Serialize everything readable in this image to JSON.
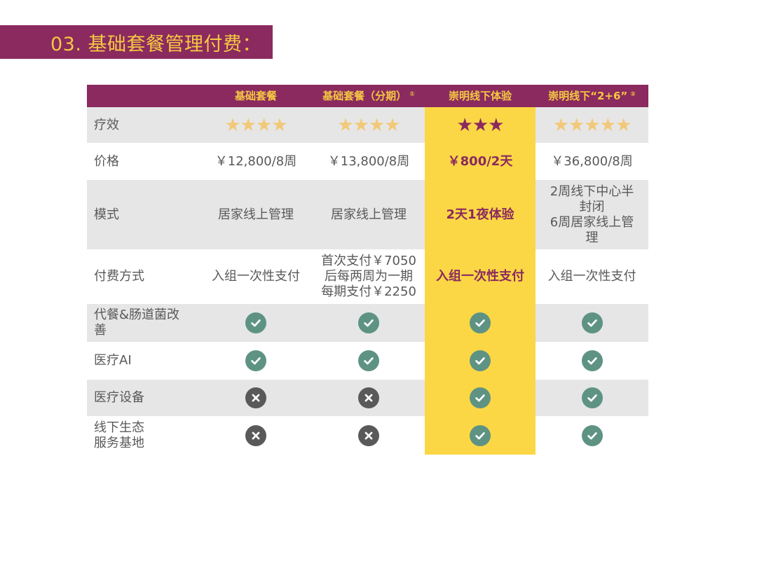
{
  "title": "03. 基础套餐管理付费：",
  "colors": {
    "accent": "#8a2a5f",
    "gold": "#f5c842",
    "highlight": "#fbd745",
    "check": "#5e9384",
    "cross": "#595959"
  },
  "header": {
    "col1": "基础套餐",
    "col2": "基础套餐（分期）",
    "col2_sup": "①",
    "col3": "崇明线下体验",
    "col4": "崇明线下“2+6”",
    "col4_sup": "②"
  },
  "rows": {
    "efficacy": {
      "label": "疗效",
      "c1": "★★★★",
      "c2": "★★★★",
      "c3": "★★★",
      "c4": "★★★★★"
    },
    "price": {
      "label": "价格",
      "c1": "￥12,800/8周",
      "c2": "￥13,800/8周",
      "c3": "￥800/2天",
      "c4": "￥36,800/8周"
    },
    "mode": {
      "label": "模式",
      "c1": "居家线上管理",
      "c2": "居家线上管理",
      "c3": "2天1夜体验",
      "c4_line1": "2周线下中心半",
      "c4_line2": "封闭",
      "c4_line3": "6周居家线上管",
      "c4_line4": "理"
    },
    "payment": {
      "label": "付费方式",
      "c1": "入组一次性支付",
      "c2_line1": "首次支付￥7050",
      "c2_line2": "后每两周为一期",
      "c2_line3": "每期支付￥2250",
      "c3": "入组一次性支付",
      "c4": "入组一次性支付"
    },
    "meal": {
      "label_line1": "代餐&肠道菌改",
      "label_line2": "善",
      "c1": "check-icon",
      "c2": "check-icon",
      "c3": "check-icon",
      "c4": "check-icon"
    },
    "ai": {
      "label": "医疗AI",
      "c1": "check-icon",
      "c2": "check-icon",
      "c3": "check-icon",
      "c4": "check-icon"
    },
    "device": {
      "label": "医疗设备",
      "c1": "cross-icon",
      "c2": "cross-icon",
      "c3": "check-icon",
      "c4": "check-icon"
    },
    "eco": {
      "label_line1": "线下生态",
      "label_line2": "服务基地",
      "c1": "cross-icon",
      "c2": "cross-icon",
      "c3": "check-icon",
      "c4": "check-icon"
    }
  }
}
